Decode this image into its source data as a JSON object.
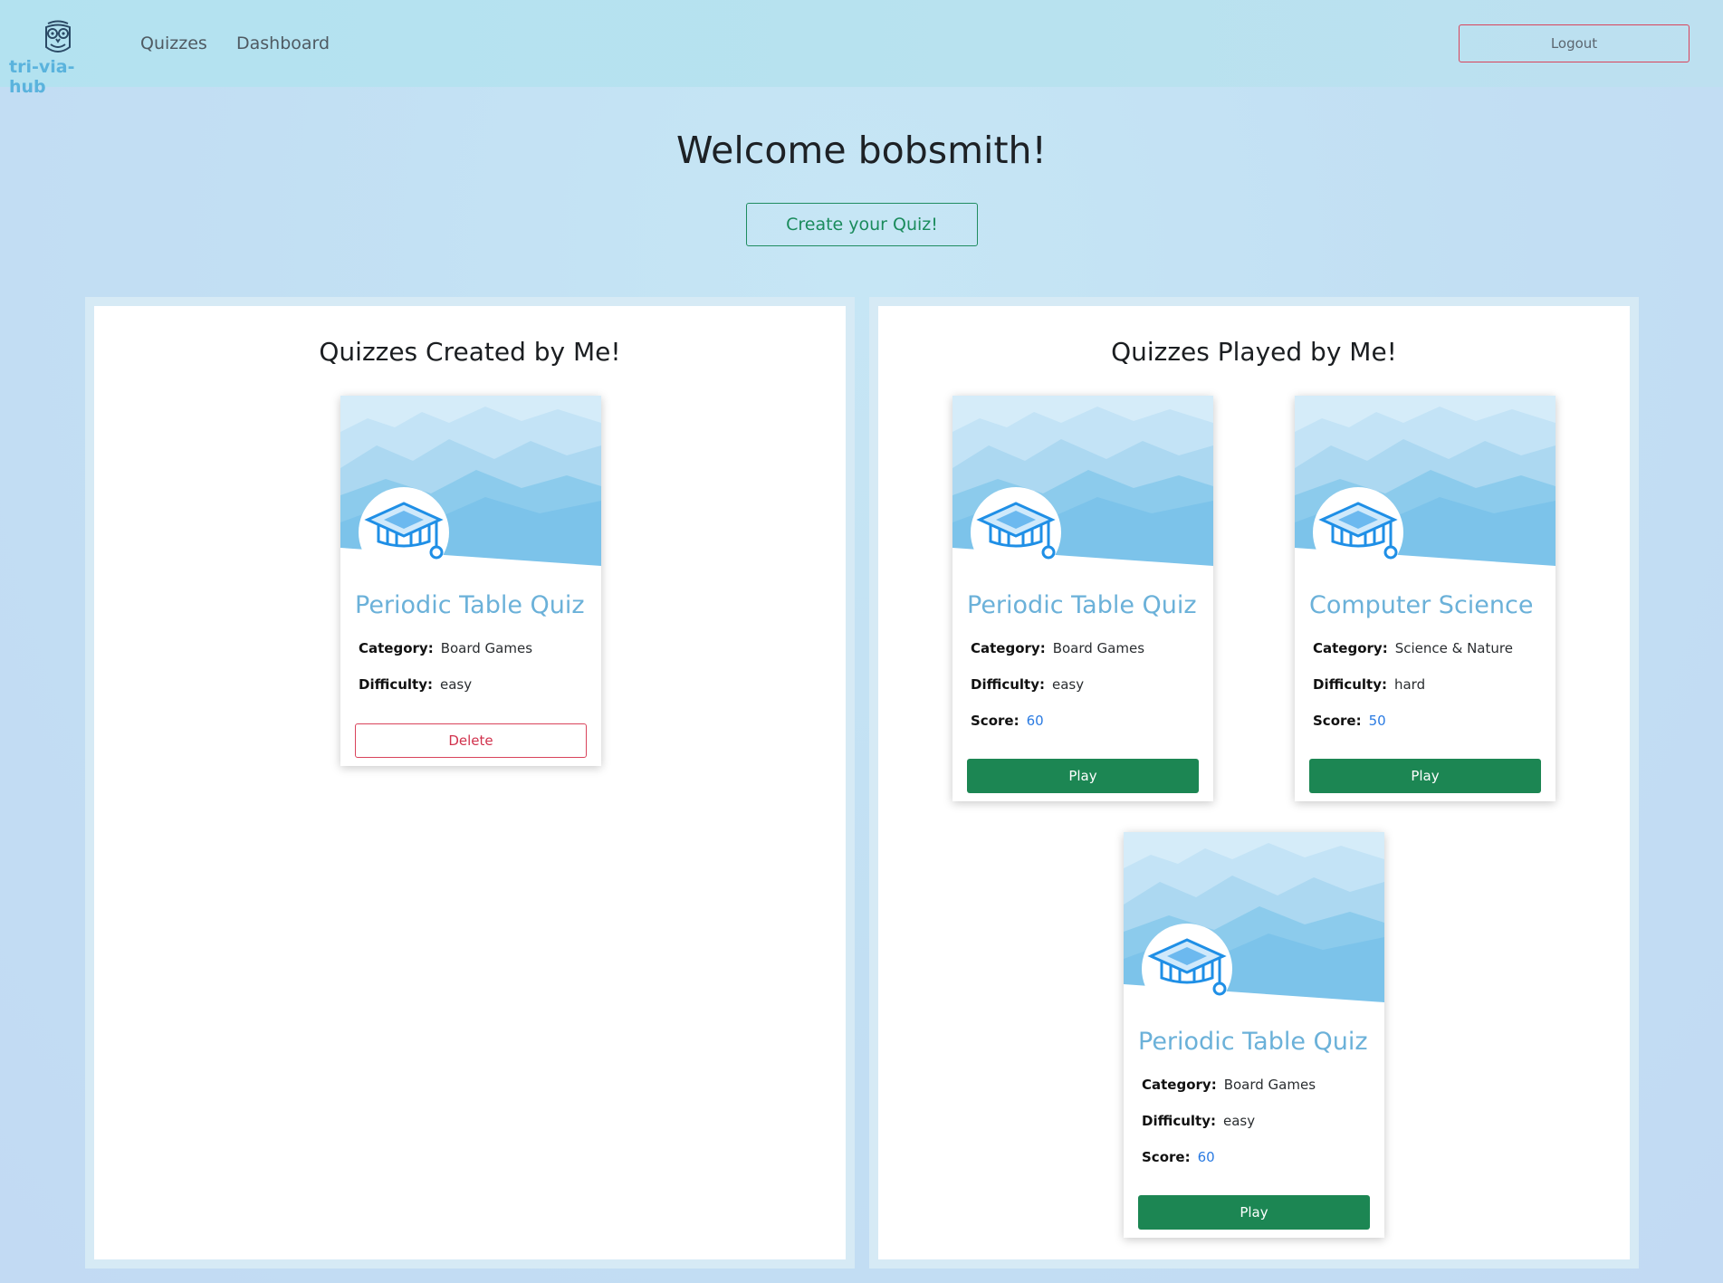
{
  "nav": {
    "brand": "tri-via-hub",
    "links": [
      "Quizzes",
      "Dashboard"
    ],
    "logout": "Logout"
  },
  "hero": {
    "welcome": "Welcome bobsmith!",
    "create_button": "Create your Quiz!"
  },
  "labels": {
    "category": "Category:",
    "difficulty": "Difficulty:",
    "score": "Score:"
  },
  "created": {
    "title": "Quizzes Created by Me!",
    "cards": [
      {
        "title": "Periodic Table Quiz",
        "category": "Board Games",
        "difficulty": "easy",
        "action": "Delete"
      }
    ]
  },
  "played": {
    "title": "Quizzes Played by Me!",
    "cards": [
      {
        "title": "Periodic Table Quiz",
        "category": "Board Games",
        "difficulty": "easy",
        "score": "60",
        "action": "Play"
      },
      {
        "title": "Computer Science",
        "category": "Science & Nature",
        "difficulty": "hard",
        "score": "50",
        "action": "Play"
      },
      {
        "title": "Periodic Table Quiz",
        "category": "Board Games",
        "difficulty": "easy",
        "score": "60",
        "action": "Play"
      }
    ]
  },
  "colors": {
    "accent_green": "#1c8653",
    "danger_red": "#d9435b",
    "card_title_blue": "#6bb1d9",
    "score_blue": "#2b7be2"
  },
  "icons": [
    "owl-logo-icon",
    "graduation-cap-icon"
  ]
}
